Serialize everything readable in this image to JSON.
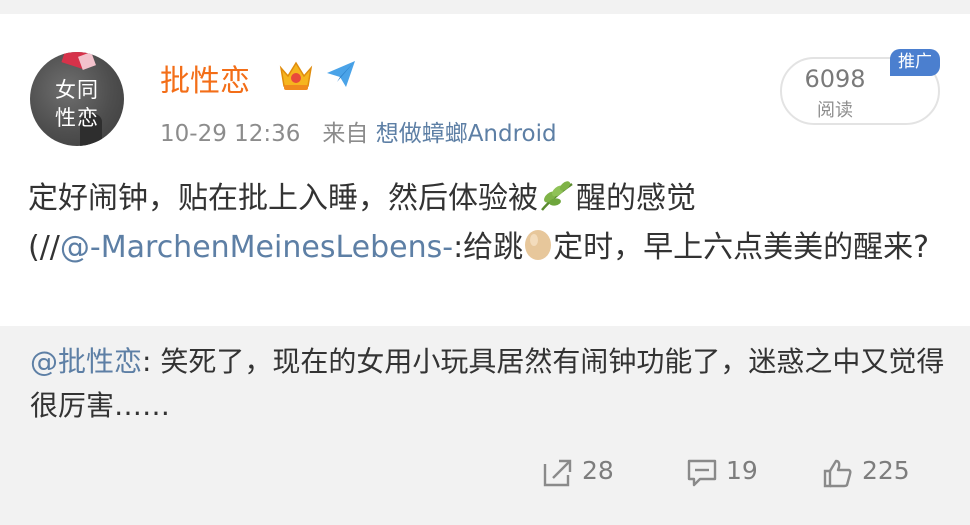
{
  "post": {
    "avatar_text_line1": "女同",
    "avatar_text_line2": "性恋",
    "username": "批性恋",
    "time": "10-29 12:36",
    "source_prefix": "来自",
    "source_name": "想做蟑螂Android",
    "read_count": "6098",
    "read_label": "阅读",
    "promo_badge": "推广",
    "text_main": "定好闹钟，贴在批上入睡，然后体验被",
    "text_after_emoji": "醒的感觉",
    "text_repost_prefix": "(//",
    "text_mention": "@-MarchenMeinesLebens-",
    "text_repost_body_1": ":给跳",
    "text_repost_body_2": "定时，早上六点美美的醒来?"
  },
  "repost": {
    "mention": "@批性恋",
    "text": ": 笑死了，现在的女用小玩具居然有闹钟功能了，迷惑之中又觉得很厉害……"
  },
  "actions": {
    "forward_count": "28",
    "comment_count": "19",
    "like_count": "225"
  },
  "colors": {
    "username": "#f36e18",
    "link": "#5d7fa5",
    "badge": "#4b7fcf",
    "repost_bg": "#f2f2f2"
  },
  "icons": {
    "crown": "crown-icon",
    "plane": "paper-plane-icon",
    "leaf": "leaf-emoji-icon",
    "egg": "egg-emoji-icon",
    "forward": "forward-icon",
    "comment": "comment-icon",
    "like": "thumbs-up-icon"
  }
}
